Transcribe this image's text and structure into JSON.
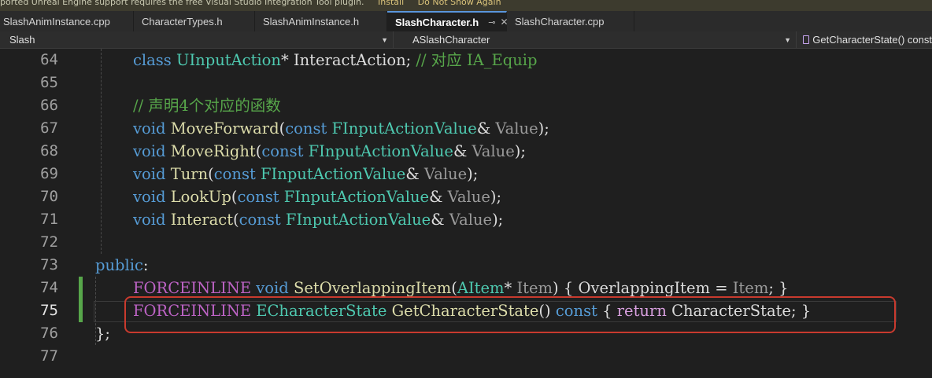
{
  "infobar": {
    "message": "ported Unreal Engine support requires the free Visual Studio Integration Tool plugin.",
    "links": [
      "Install",
      "Do Not Show Again"
    ]
  },
  "tabs": [
    {
      "label": "SlashAnimInstance.cpp",
      "active": false
    },
    {
      "label": "CharacterTypes.h",
      "active": false
    },
    {
      "label": "SlashAnimInstance.h",
      "active": false
    },
    {
      "label": "SlashCharacter.h",
      "active": true,
      "pin_icon": "pin-icon",
      "close_icon": "close-icon"
    },
    {
      "label": "SlashCharacter.cpp",
      "active": false
    }
  ],
  "navbar": {
    "project": "Slash",
    "scope": "ASlashCharacter",
    "member": "GetCharacterState() const",
    "member_icon": "method-icon",
    "dropdown_icon": "chevron-down-icon"
  },
  "editor": {
    "colors": {
      "keyword": "#569cd6",
      "comment": "#57a64a",
      "type": "#4ec9b0",
      "function": "#dcdcaa",
      "macro": "#bd63c5",
      "parameter": "#9a9a9a",
      "highlight_box": "#c93a2e",
      "change_bar": "#57a64a"
    },
    "lines": [
      {
        "num": "64",
        "tokens": [
          {
            "t": "class",
            "c": "kw"
          },
          {
            "t": " "
          },
          {
            "t": "UInputAction",
            "c": "ty"
          },
          {
            "t": "* InteractAction; "
          },
          {
            "t": "// 对应 IA_Equip",
            "c": "cm"
          }
        ]
      },
      {
        "num": "65",
        "tokens": []
      },
      {
        "num": "66",
        "tokens": [
          {
            "t": "// 声明4个对应的函数",
            "c": "cm"
          }
        ]
      },
      {
        "num": "67",
        "tokens": [
          {
            "t": "void",
            "c": "kw"
          },
          {
            "t": " "
          },
          {
            "t": "MoveForward",
            "c": "fn"
          },
          {
            "t": "("
          },
          {
            "t": "const",
            "c": "kw"
          },
          {
            "t": " "
          },
          {
            "t": "FInputActionValue",
            "c": "ty"
          },
          {
            "t": "& "
          },
          {
            "t": "Value",
            "c": "pm"
          },
          {
            "t": ");"
          }
        ]
      },
      {
        "num": "68",
        "tokens": [
          {
            "t": "void",
            "c": "kw"
          },
          {
            "t": " "
          },
          {
            "t": "MoveRight",
            "c": "fn"
          },
          {
            "t": "("
          },
          {
            "t": "const",
            "c": "kw"
          },
          {
            "t": " "
          },
          {
            "t": "FInputActionValue",
            "c": "ty"
          },
          {
            "t": "& "
          },
          {
            "t": "Value",
            "c": "pm"
          },
          {
            "t": ");"
          }
        ]
      },
      {
        "num": "69",
        "tokens": [
          {
            "t": "void",
            "c": "kw"
          },
          {
            "t": " "
          },
          {
            "t": "Turn",
            "c": "fn"
          },
          {
            "t": "("
          },
          {
            "t": "const",
            "c": "kw"
          },
          {
            "t": " "
          },
          {
            "t": "FInputActionValue",
            "c": "ty"
          },
          {
            "t": "& "
          },
          {
            "t": "Value",
            "c": "pm"
          },
          {
            "t": ");"
          }
        ]
      },
      {
        "num": "70",
        "tokens": [
          {
            "t": "void",
            "c": "kw"
          },
          {
            "t": " "
          },
          {
            "t": "LookUp",
            "c": "fn"
          },
          {
            "t": "("
          },
          {
            "t": "const",
            "c": "kw"
          },
          {
            "t": " "
          },
          {
            "t": "FInputActionValue",
            "c": "ty"
          },
          {
            "t": "& "
          },
          {
            "t": "Value",
            "c": "pm"
          },
          {
            "t": ");"
          }
        ]
      },
      {
        "num": "71",
        "tokens": [
          {
            "t": "void",
            "c": "kw"
          },
          {
            "t": " "
          },
          {
            "t": "Interact",
            "c": "fn"
          },
          {
            "t": "("
          },
          {
            "t": "const",
            "c": "kw"
          },
          {
            "t": " "
          },
          {
            "t": "FInputActionValue",
            "c": "ty"
          },
          {
            "t": "& "
          },
          {
            "t": "Value",
            "c": "pm"
          },
          {
            "t": ");"
          }
        ]
      },
      {
        "num": "72",
        "tokens": []
      },
      {
        "num": "73",
        "tokens": [
          {
            "t": "public",
            "c": "kw"
          },
          {
            "t": ":"
          }
        ]
      },
      {
        "num": "74",
        "tokens": [
          {
            "t": "FORCEINLINE",
            "c": "mac"
          },
          {
            "t": " "
          },
          {
            "t": "void",
            "c": "kw"
          },
          {
            "t": " "
          },
          {
            "t": "SetOverlappingItem",
            "c": "fn"
          },
          {
            "t": "("
          },
          {
            "t": "AItem",
            "c": "ty"
          },
          {
            "t": "* "
          },
          {
            "t": "Item",
            "c": "pm"
          },
          {
            "t": ") { OverlappingItem = "
          },
          {
            "t": "Item",
            "c": "pm"
          },
          {
            "t": "; }"
          }
        ]
      },
      {
        "num": "75",
        "tokens": [
          {
            "t": "FORCEINLINE",
            "c": "mac"
          },
          {
            "t": " "
          },
          {
            "t": "ECharacterState",
            "c": "ty"
          },
          {
            "t": " "
          },
          {
            "t": "GetCharacterState",
            "c": "fn"
          },
          {
            "t": "() "
          },
          {
            "t": "const",
            "c": "kw"
          },
          {
            "t": " { "
          },
          {
            "t": "return",
            "c": "ctl"
          },
          {
            "t": " CharacterState; }"
          }
        ]
      },
      {
        "num": "76",
        "tokens": [
          {
            "t": "};"
          }
        ]
      },
      {
        "num": "77",
        "tokens": []
      }
    ]
  }
}
